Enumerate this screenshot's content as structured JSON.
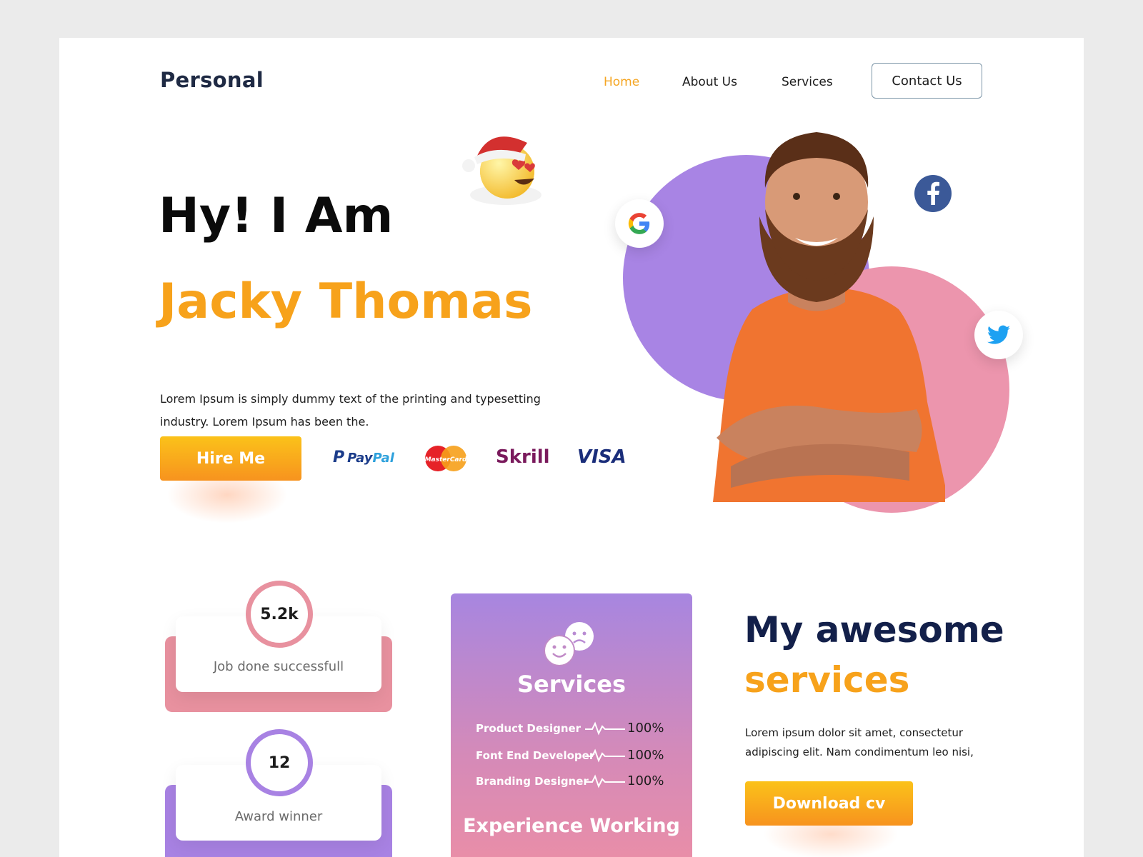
{
  "header": {
    "logo": "Personal",
    "nav": {
      "home": "Home",
      "about": "About Us",
      "services": "Services",
      "contact": "Contact Us"
    }
  },
  "hero": {
    "greeting": "Hy! I Am",
    "name": "Jacky Thomas",
    "description": "Lorem Ipsum is simply dummy text of the printing and typesetting industry. Lorem Ipsum has been the.",
    "hire_button": "Hire Me",
    "payments": {
      "paypal_pay": "Pay",
      "paypal_pal": "Pal",
      "mastercard": "MasterCard",
      "skrill": "Skrill",
      "visa": "VISA"
    }
  },
  "stats": [
    {
      "value": "5.2k",
      "label": "Job done successfull",
      "color": "#e8919f"
    },
    {
      "value": "12",
      "label": "Award winner",
      "color": "#a882e3"
    }
  ],
  "services_card": {
    "title": "Services",
    "rows": [
      {
        "name": "Product Designer",
        "percent": "100%"
      },
      {
        "name": "Font End Developer",
        "percent": "100%"
      },
      {
        "name": "Branding Designer",
        "percent": "100%"
      }
    ],
    "experience": "Experience Working"
  },
  "awesome": {
    "line1": "My awesome",
    "line2": "services",
    "description": "Lorem ipsum dolor sit amet, consectetur adipiscing elit. Nam condimentum leo nisi,",
    "download_button": "Download cv"
  },
  "colors": {
    "accent_orange": "#f7a21b",
    "purple": "#a884e4",
    "pink": "#ec95ad",
    "navy": "#13204a"
  }
}
